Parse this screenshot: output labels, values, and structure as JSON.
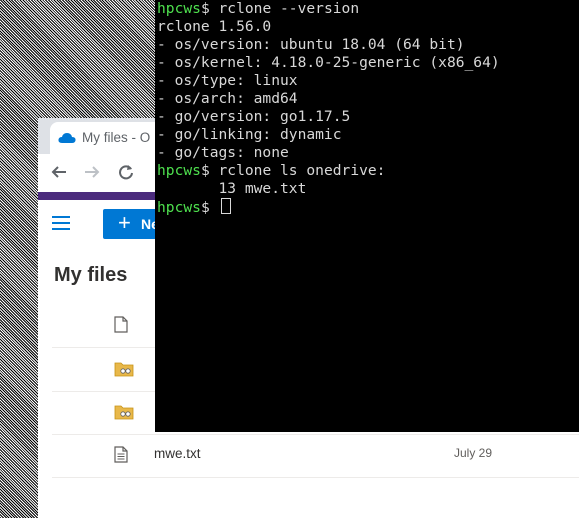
{
  "browser": {
    "tab_title": "My files - O",
    "new_button_label": "Ne",
    "page_title": "My files",
    "files": [
      {
        "icon": "document-icon",
        "name": "",
        "date": ""
      },
      {
        "icon": "shared-folder-icon",
        "name": "",
        "date": ""
      },
      {
        "icon": "shared-folder-icon",
        "name": "",
        "date": ""
      },
      {
        "icon": "text-file-icon",
        "name": "mwe.txt",
        "date": "July 29"
      }
    ]
  },
  "terminal": {
    "prompt_host": "hpcws",
    "prompt_symbol": "$",
    "lines": [
      {
        "type": "cmd",
        "text": " rclone --version"
      },
      {
        "type": "out",
        "text": "rclone 1.56.0"
      },
      {
        "type": "out",
        "text": "- os/version: ubuntu 18.04 (64 bit)"
      },
      {
        "type": "out",
        "text": "- os/kernel: 4.18.0-25-generic (x86_64)"
      },
      {
        "type": "out",
        "text": "- os/type: linux"
      },
      {
        "type": "out",
        "text": "- os/arch: amd64"
      },
      {
        "type": "out",
        "text": "- go/version: go1.17.5"
      },
      {
        "type": "out",
        "text": "- go/linking: dynamic"
      },
      {
        "type": "out",
        "text": "- go/tags: none"
      },
      {
        "type": "cmd",
        "text": " rclone ls onedrive:"
      },
      {
        "type": "out",
        "text": "       13 mwe.txt"
      },
      {
        "type": "cmd",
        "text": " "
      }
    ]
  },
  "colors": {
    "prompt_green": "#4ee04e",
    "terminal_text": "#d8d8d8",
    "onedrive_blue": "#0078d4",
    "accent_purple": "#4b2b7d"
  }
}
